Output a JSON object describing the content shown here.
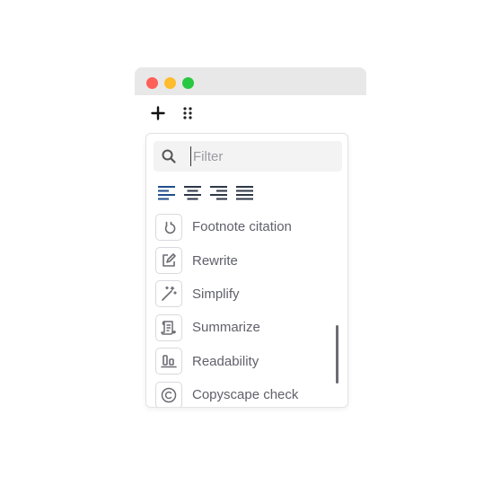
{
  "window": {
    "controls": [
      "close",
      "minimize",
      "zoom"
    ]
  },
  "toolbar": {
    "add_icon": "plus-icon",
    "drag_icon": "drag-handle-icon"
  },
  "filter": {
    "placeholder": "Filter",
    "value": ""
  },
  "alignment": [
    {
      "icon": "align-left-icon",
      "active": true
    },
    {
      "icon": "align-center-icon",
      "active": false
    },
    {
      "icon": "align-right-icon",
      "active": false
    },
    {
      "icon": "align-justify-icon",
      "active": false
    }
  ],
  "commands": [
    {
      "label": "Footnote citation",
      "icon": "footnote-icon"
    },
    {
      "label": "Rewrite",
      "icon": "edit-icon"
    },
    {
      "label": "Simplify",
      "icon": "magic-wand-icon"
    },
    {
      "label": "Summarize",
      "icon": "scroll-icon"
    },
    {
      "label": "Readability",
      "icon": "readability-icon"
    },
    {
      "label": "Copyscape check",
      "icon": "copyright-icon"
    }
  ],
  "colors": {
    "accent": "#1f4e8c",
    "label": "#60606b",
    "icon": "#6b6b73"
  }
}
